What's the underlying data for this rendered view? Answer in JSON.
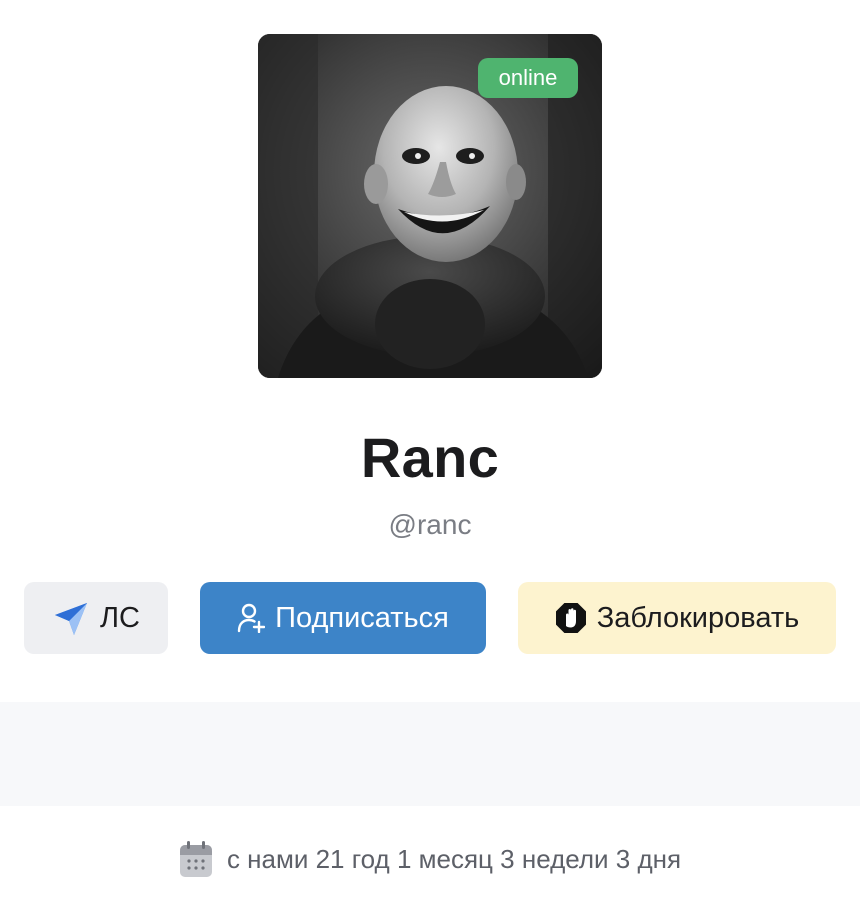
{
  "profile": {
    "status_badge": "online",
    "display_name": "Ranc",
    "username": "@ranc"
  },
  "actions": {
    "pm_label": "ЛС",
    "subscribe_label": "Подписаться",
    "block_label": "Заблокировать"
  },
  "member_since": {
    "text": "с нами 21 год 1 месяц 3 недели 3 дня"
  },
  "icons": {
    "pm": "paper-plane-icon",
    "subscribe": "user-plus-icon",
    "block": "stop-hand-icon",
    "calendar": "calendar-icon"
  },
  "colors": {
    "online": "#4fb46f",
    "subscribe_bg": "#3d84c8",
    "block_bg": "#fdf3cf",
    "pm_bg": "#eeeff2",
    "pm_icon": "#3d84e6"
  }
}
